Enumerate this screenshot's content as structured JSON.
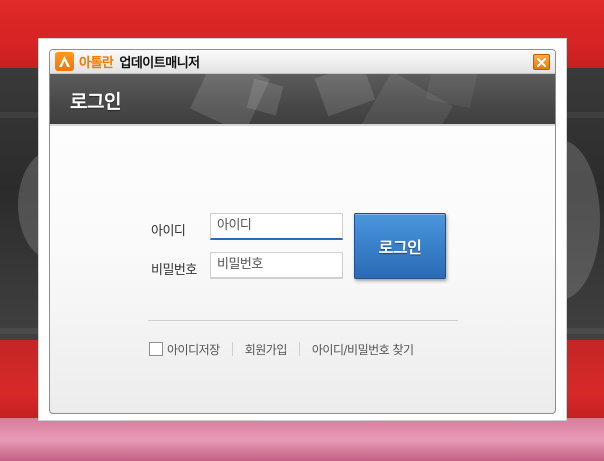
{
  "window": {
    "brand": "아톨란",
    "title": "업데이트매니저",
    "close_label": "×"
  },
  "banner": {
    "title": "로그인"
  },
  "form": {
    "id_label": "아이디",
    "id_value": "아이디",
    "password_label": "비밀번호",
    "password_value": "비밀번호",
    "login_button": "로그인"
  },
  "footer": {
    "remember_id": "아이디저장",
    "signup": "회원가입",
    "find_account": "아이디/비밀번호 찾기"
  },
  "colors": {
    "brand_orange": "#f07a00",
    "button_blue": "#3a82cc",
    "banner_dark": "#4a4a4a"
  },
  "icons": [
    "logo-icon",
    "close-icon"
  ]
}
